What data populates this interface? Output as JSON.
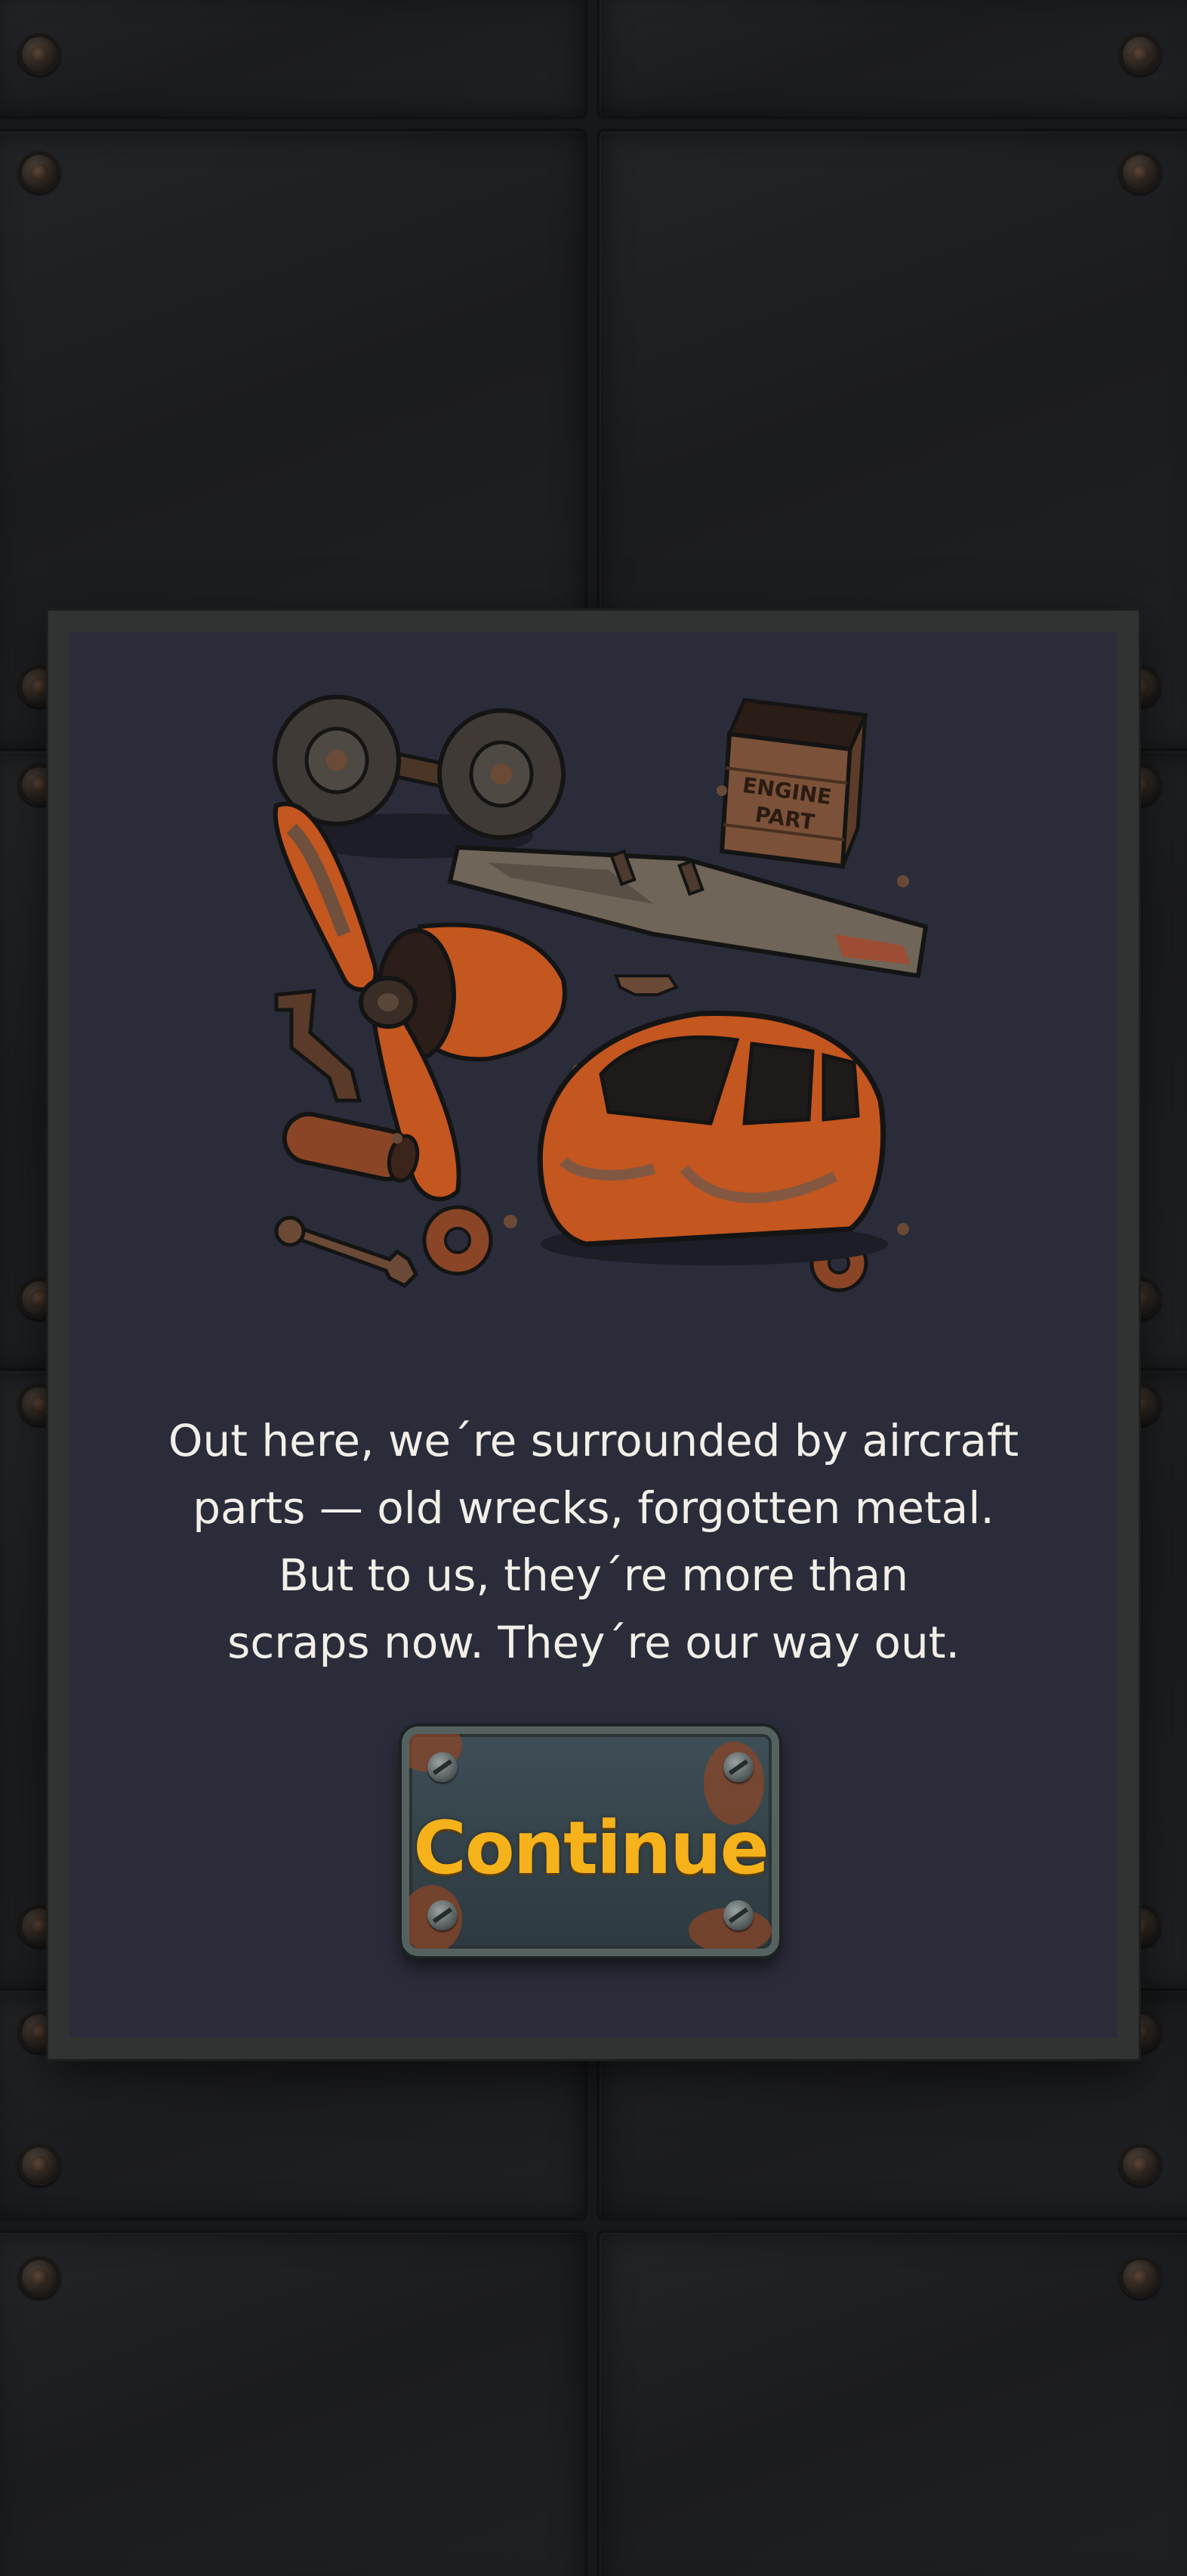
{
  "story": {
    "lines": [
      "Out here, we´re surrounded by aircraft",
      "parts — old wrecks, forgotten metal.",
      "But to us, they´re more than",
      "scraps now. They´re our way out."
    ]
  },
  "illustration": {
    "crate_label_line1": "ENGINE",
    "crate_label_line2": "PART"
  },
  "buttons": {
    "continue_label": "Continue"
  },
  "colors": {
    "panel_background": "#2b2c3a",
    "panel_border": "#2f3432",
    "button_text": "#f6b21a",
    "rust_orange": "#c4561f",
    "background_metal": "#1b1c1f"
  }
}
